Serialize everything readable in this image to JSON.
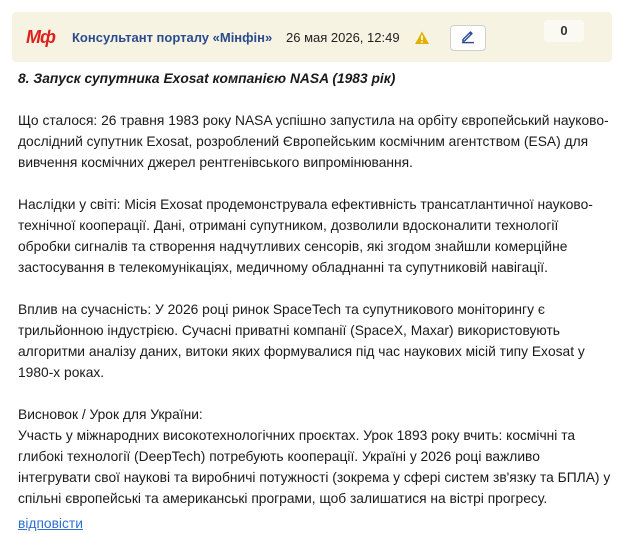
{
  "header": {
    "logo_text": "Мф",
    "author": "Консультант порталу «Мінфін»",
    "date": "26 мая 2026, 12:49",
    "vote_count": "0",
    "icons": {
      "warning": "warning-icon",
      "edit": "pencil-icon"
    },
    "colors": {
      "logo": "#e0201c",
      "author": "#2b4b8f",
      "header_bg": "#f6f3e2",
      "warning": "#e2b100"
    }
  },
  "post": {
    "title": "8. Запуск супутника Exosat компанією NASA (1983 рік)",
    "p1": "Що сталося: 26 травня 1983 року NASA успішно запустила на орбіту європейський науково-дослідний супутник Exosat, розроблений Європейським космічним агентством (ESA) для вивчення космічних джерел рентгенівського випромінювання.",
    "p2": "Наслідки у світі: Місія Exosat продемонструвала ефективність трансатлантичної науково-технічної кооперації. Дані, отримані супутником, дозволили вдосконалити технології обробки сигналів та створення надчутливих сенсорів, які згодом знайшли комерційне застосування в телекомунікаціях, медичному обладнанні та супутниковій навігації.",
    "p3": "Вплив на сучасність: У 2026 році ринок SpaceTech та супутникового моніторингу є трильйонною індустрією. Сучасні приватні компанії (SpaceX, Maxar) використовують алгоритми аналізу даних, витоки яких формувалися під час наукових місій типу Exosat у 1980-х роках.",
    "p4_heading": "Висновок / Урок для України:",
    "p4": "Участь у міжнародних високотехнологічних проєктах. Урок 1893 року вчить: космічні та глибокі технології (DeepTech) потребують кооперації. Україні у 2026 році важливо інтегрувати свої наукові та виробничі потужності (зокрема у сфері систем зв'язку та БПЛА) у спільні європейські та американські програми, щоб залишатися на вістрі прогресу.",
    "reply": "відповісти"
  }
}
